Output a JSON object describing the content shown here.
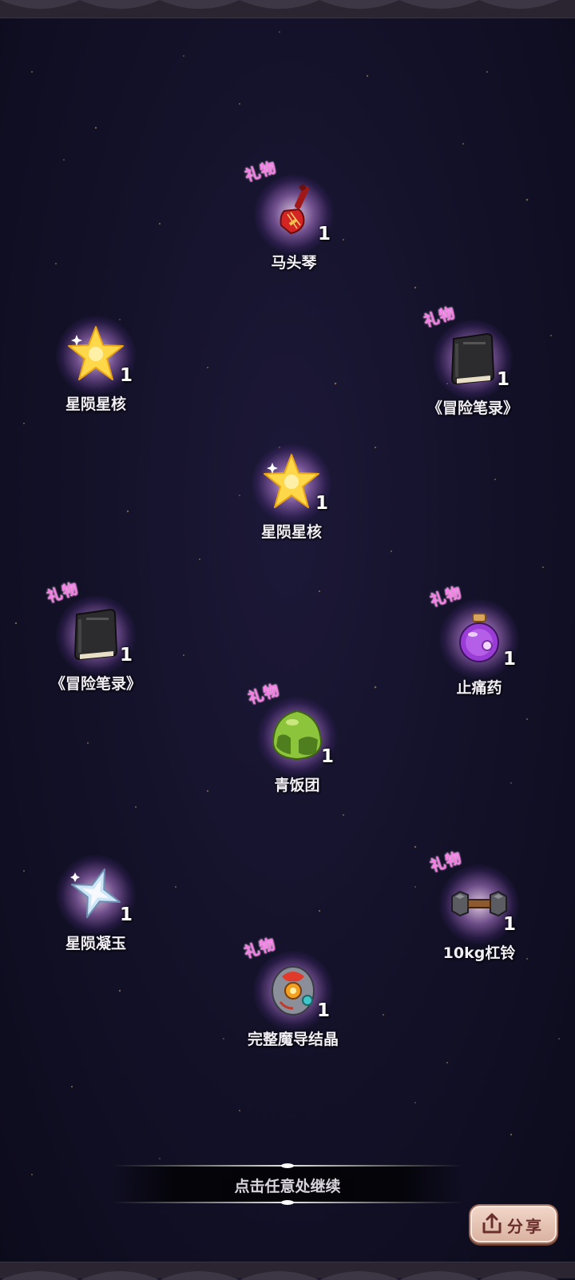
{
  "gift_tag": "礼物",
  "items": [
    {
      "id": "horse-fiddle",
      "name": "马头琴",
      "qty": "1",
      "gift": true,
      "icon": "horse-head-fiddle-icon"
    },
    {
      "id": "star-core-1",
      "name": "星陨星核",
      "qty": "1",
      "gift": false,
      "icon": "star-core-icon"
    },
    {
      "id": "notes-1",
      "name": "《冒险笔录》",
      "qty": "1",
      "gift": true,
      "icon": "black-book-icon"
    },
    {
      "id": "star-core-2",
      "name": "星陨星核",
      "qty": "1",
      "gift": false,
      "icon": "star-core-icon"
    },
    {
      "id": "notes-2",
      "name": "《冒险笔录》",
      "qty": "1",
      "gift": true,
      "icon": "black-book-icon"
    },
    {
      "id": "painkiller",
      "name": "止痛药",
      "qty": "1",
      "gift": true,
      "icon": "potion-bottle-icon"
    },
    {
      "id": "rice-ball",
      "name": "青饭团",
      "qty": "1",
      "gift": true,
      "icon": "green-rice-ball-icon"
    },
    {
      "id": "star-jade",
      "name": "星陨凝玉",
      "qty": "1",
      "gift": false,
      "icon": "crystal-star-icon"
    },
    {
      "id": "dumbbell",
      "name": "10kg杠铃",
      "qty": "1",
      "gift": true,
      "icon": "dumbbell-icon"
    },
    {
      "id": "crystal",
      "name": "完整魔导结晶",
      "qty": "1",
      "gift": true,
      "icon": "magic-crystal-icon"
    }
  ],
  "continue_text": "点击任意处继续",
  "share_label": "分享",
  "colors": {
    "gift_tag": "#f57ee6",
    "background": "#14122a"
  }
}
